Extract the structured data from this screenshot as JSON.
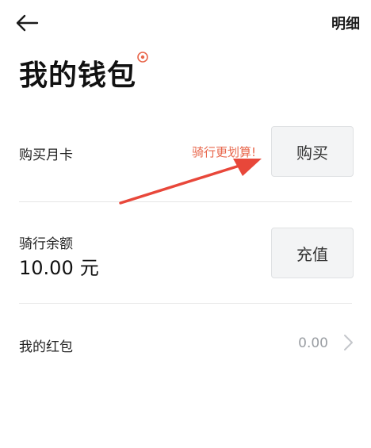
{
  "header": {
    "detail_label": "明细"
  },
  "page": {
    "title": "我的钱包"
  },
  "monthly_card": {
    "label": "购买月卡",
    "promo": "骑行更划算!",
    "button_label": "购买"
  },
  "balance": {
    "label": "骑行余额",
    "value": "10.00",
    "unit": "元",
    "button_label": "充值"
  },
  "red_packet": {
    "label": "我的红包",
    "value": "0.00"
  },
  "colors": {
    "promo": "#e8674c",
    "annotation_arrow": "#e8473a"
  },
  "icons": {
    "back": "arrow-left-icon",
    "title_badge": "ring-dot-icon",
    "chevron": "chevron-right-icon"
  }
}
